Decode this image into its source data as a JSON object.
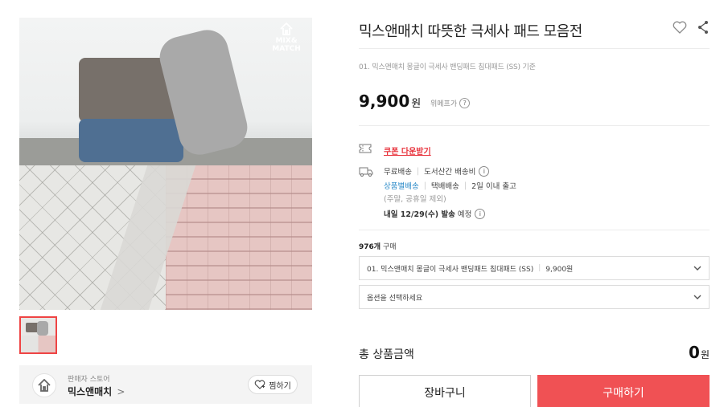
{
  "gallery": {
    "brand_logo_text": "MIX& MATCH",
    "selected_thumbnail_index": 0
  },
  "store": {
    "caption": "판매자 스토어",
    "name": "믹스앤매치",
    "chevron": ">",
    "favorite_label": "찜하기"
  },
  "product": {
    "title": "믹스앤매치 따뜻한 극세사 패드 모음전",
    "subtitle": "01. 믹스앤매치 몽글이 극세사 밴딩패드 침대패드 (SS) 기준",
    "price": "9,900",
    "currency": "원",
    "price_note": "위메프가"
  },
  "shipping": {
    "coupon_label": "쿠폰 다운받기",
    "row1": {
      "free": "무료배송",
      "area": "도서산간 배송비"
    },
    "row2": {
      "per_item": "상품별배송",
      "courier": "택배배송",
      "eta": "2일 이내 출고"
    },
    "row3": {
      "note": "(주말, 공휴일 제외)"
    },
    "row4": {
      "arrival": "내일 12/29(수) 발송",
      "suffix": "예정"
    }
  },
  "order": {
    "purchase_count": "976개",
    "purchase_suffix": "구매",
    "selected_option": "01. 믹스앤매치 몽글이 극세사 밴딩패드 침대패드 (SS)",
    "selected_option_price": "9,900원",
    "option_placeholder": "옵션을 선택하세요"
  },
  "total": {
    "label": "총 상품금액",
    "value": "0",
    "currency": "원"
  },
  "buttons": {
    "cart": "장바구니",
    "buy": "구매하기"
  },
  "colors": {
    "accent": "#f05154",
    "coupon": "#e8323c",
    "link_blue": "#2a8ac8"
  }
}
